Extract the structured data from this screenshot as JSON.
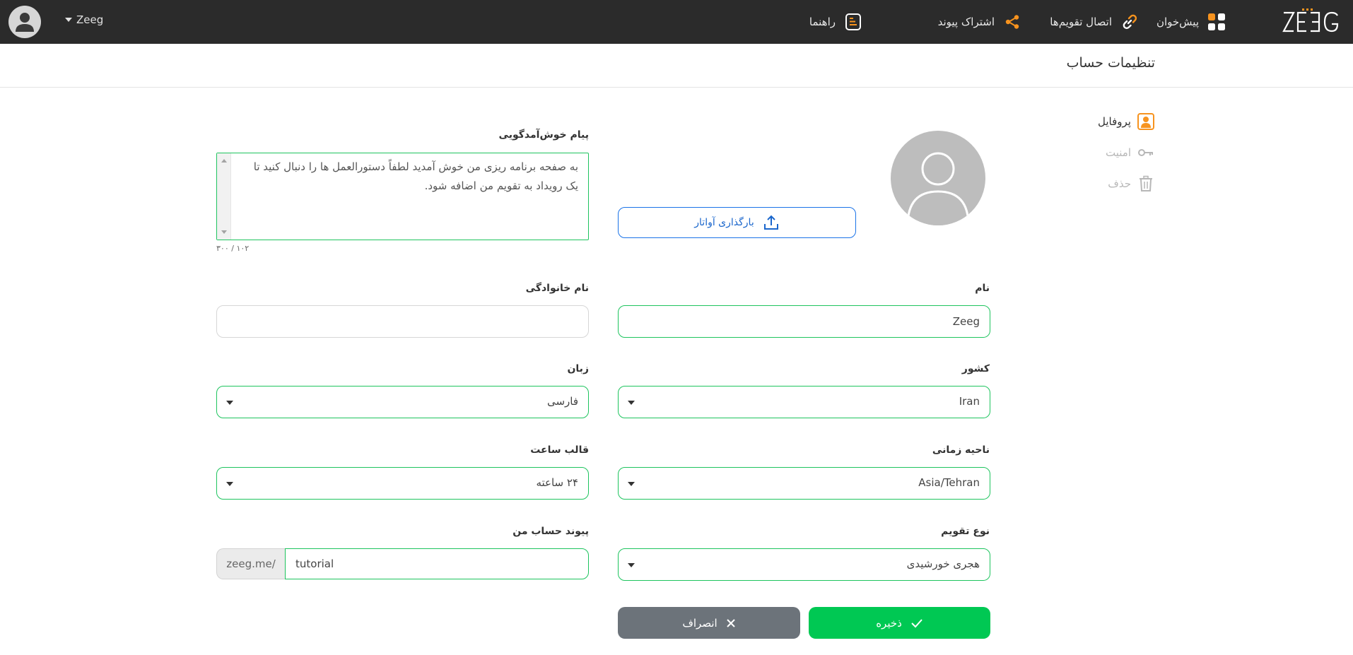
{
  "topbar": {
    "logo_text": "ZEEG",
    "nav": {
      "dashboard": "پیش‌خوان",
      "connect_calendars": "اتصال تقویم‌ها",
      "share_link": "اشتراک پیوند",
      "help": "راهنما"
    },
    "user_name": "Zeeg",
    "accent_color": "#f7931e"
  },
  "page": {
    "title": "تنظیمات حساب"
  },
  "sidebar": {
    "items": [
      {
        "label": "پروفایل",
        "icon": "profile-icon",
        "active": true
      },
      {
        "label": "امنیت",
        "icon": "key-icon",
        "active": false
      },
      {
        "label": "حذف",
        "icon": "trash-icon",
        "active": false
      }
    ]
  },
  "profile": {
    "welcome_label": "پیام خوش‌آمدگویی",
    "welcome_text": "به صفحه برنامه ریزی من خوش آمدید لطفاً دستورالعمل ها را دنبال کنید تا یک رویداد به تقویم من اضافه شود.",
    "welcome_counter": "۱۰۲ / ۳۰۰",
    "upload_avatar_label": "بارگذاری آواتار",
    "first_name_label": "نام",
    "first_name_value": "Zeeg",
    "last_name_label": "نام خانوادگی",
    "last_name_value": "",
    "country_label": "کشور",
    "country_value": "Iran",
    "language_label": "زبان",
    "language_value": "فارسی",
    "timezone_label": "ناحیه زمانی",
    "timezone_value": "Asia/Tehran",
    "time_format_label": "قالب ساعت",
    "time_format_value": "۲۴ ساعته",
    "calendar_type_label": "نوع تقویم",
    "calendar_type_value": "هجری خورشیدی",
    "account_link_label": "پیوند حساب من",
    "account_link_prefix": "zeeg.me/",
    "account_link_value": "tutorial"
  },
  "actions": {
    "save_label": "ذخیره",
    "cancel_label": "انصراف"
  },
  "colors": {
    "success_green": "#00c853",
    "field_border": "#1ec45e",
    "link_blue": "#1a73e8",
    "cancel_gray": "#6c737a"
  }
}
